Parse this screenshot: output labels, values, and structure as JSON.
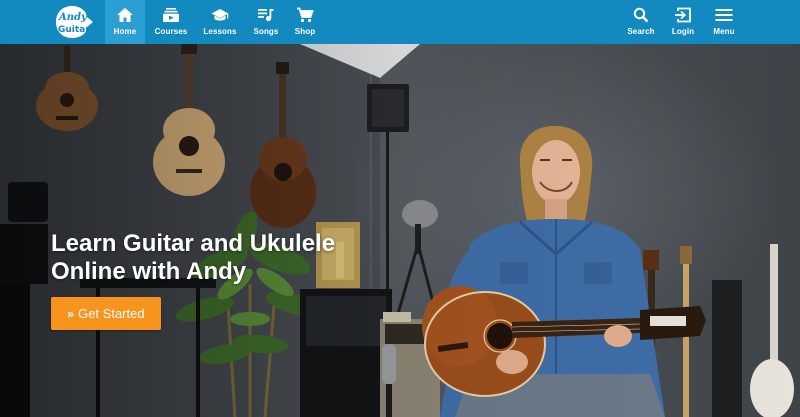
{
  "brand": {
    "logo_text_top": "Andy",
    "logo_text_bottom": "Guitar",
    "primary_color": "#1289bf",
    "active_color": "#2b9fd1",
    "cta_color": "#f7941d"
  },
  "nav": {
    "left": [
      {
        "label": "Home",
        "icon": "home-icon",
        "active": true
      },
      {
        "label": "Courses",
        "icon": "courses-icon",
        "active": false
      },
      {
        "label": "Lessons",
        "icon": "lessons-icon",
        "active": false
      },
      {
        "label": "Songs",
        "icon": "songs-icon",
        "active": false
      },
      {
        "label": "Shop",
        "icon": "cart-icon",
        "active": false
      }
    ],
    "right": [
      {
        "label": "Search",
        "icon": "search-icon"
      },
      {
        "label": "Login",
        "icon": "login-icon"
      },
      {
        "label": "Menu",
        "icon": "menu-icon"
      }
    ]
  },
  "hero": {
    "title": "Learn Guitar and Ukulele Online with Andy",
    "cta_label": "Get Started",
    "cta_icon": "double-chevron-icon"
  }
}
